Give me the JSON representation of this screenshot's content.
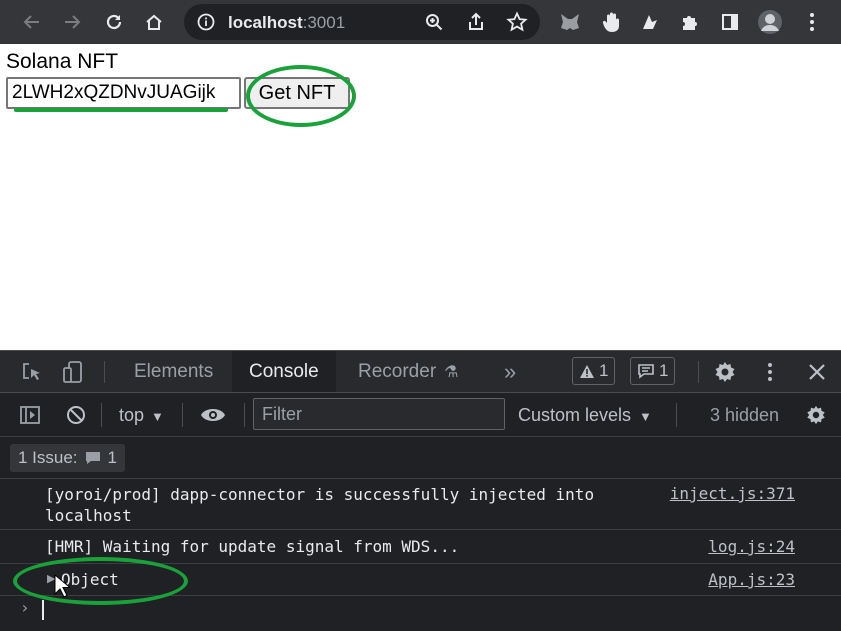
{
  "browser": {
    "url_host": "localhost",
    "url_port": ":3001"
  },
  "page": {
    "title": "Solana NFT",
    "mint_input_value": "2LWH2xQZDNvJUAGijk",
    "get_nft_label": "Get NFT"
  },
  "devtools": {
    "tabs": [
      "Elements",
      "Console",
      "Recorder"
    ],
    "active_tab": "Console",
    "more_tabs": "»",
    "warnings_count": "1",
    "messages_count": "1",
    "context": "top",
    "filter_placeholder": "Filter",
    "levels": "Custom levels",
    "hidden": "3 hidden",
    "issues_label": "1 Issue:",
    "issues_count": "1",
    "logs": [
      {
        "message": "[yoroi/prod] dapp-connector is successfully injected into\nlocalhost",
        "source": "inject.js:371"
      },
      {
        "message": "[HMR] Waiting for update signal from WDS...",
        "source": "log.js:24"
      },
      {
        "message": "Object",
        "source": "App.js:23"
      }
    ],
    "prompt": "›"
  },
  "annotations": {
    "color": "#1aa23a"
  }
}
